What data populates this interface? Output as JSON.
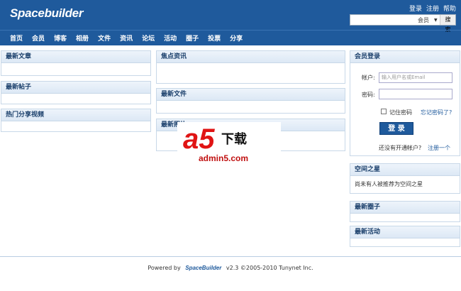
{
  "header": {
    "logo": "Spacebuilder",
    "links": [
      "登录",
      "注册",
      "帮助"
    ],
    "search": {
      "placeholder": "",
      "scope": "会员",
      "button": "搜索"
    }
  },
  "nav": [
    "首页",
    "会员",
    "博客",
    "相册",
    "文件",
    "资讯",
    "论坛",
    "活动",
    "圈子",
    "投票",
    "分享"
  ],
  "left": {
    "articles": "最新文章",
    "posts": "最新帖子",
    "videos": "热门分享视频"
  },
  "middle": {
    "news": "焦点资讯",
    "files": "最新文件",
    "photos": "最新照片"
  },
  "login": {
    "title": "会员登录",
    "account_label": "帐户:",
    "account_placeholder": "输入用户名或Email",
    "password_label": "密码:",
    "remember": "记住密码",
    "forgot": "忘记密码了?",
    "button": "登 录",
    "no_account": "还没有开通帐户?",
    "register": "注册一个"
  },
  "star": {
    "title": "空间之星",
    "text": "尚未有人被推荐为空间之星"
  },
  "groups": "最新圈子",
  "events": "最新活动",
  "footer": {
    "powered": "Powered by",
    "brand": "SpaceBuilder",
    "version": "v2.3 ©2005-2010 Tunynet Inc."
  },
  "watermark": {
    "logo": "a5",
    "text": "下载",
    "url": "admin5.com"
  },
  "colors": {
    "header": "#1f5a9c",
    "box_border": "#c8d8e8",
    "title": "#1a3f6b"
  }
}
